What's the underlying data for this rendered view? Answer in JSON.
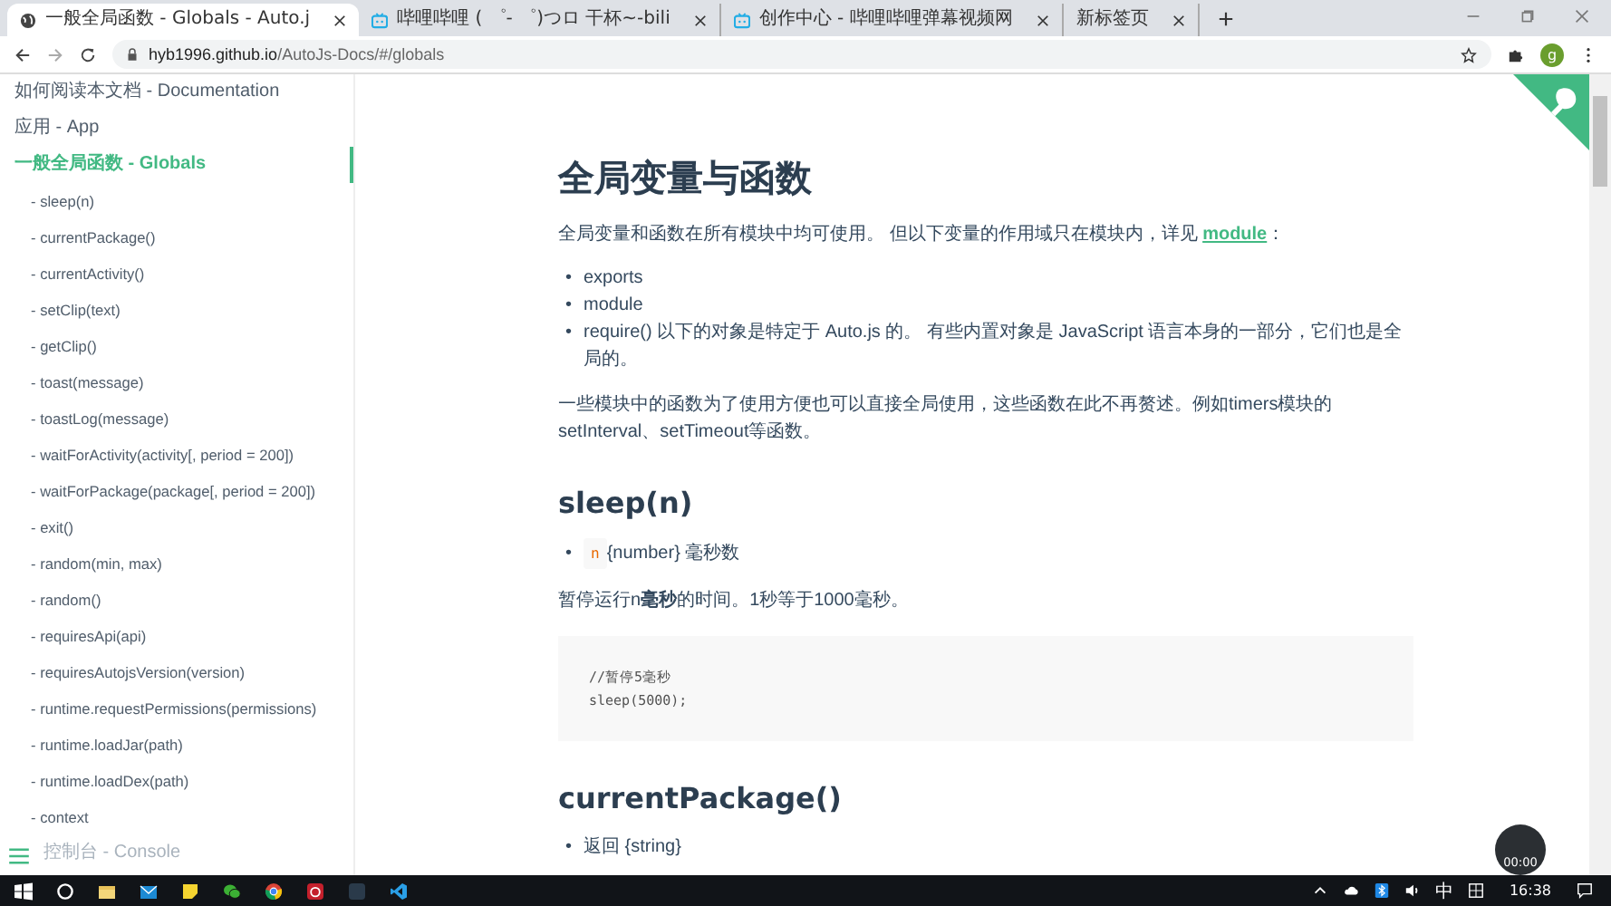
{
  "tabs": [
    {
      "title": "一般全局函数 - Globals - Auto.j",
      "kind": "globe",
      "selected": true
    },
    {
      "title": "哔哩哔哩 ( ゜- ゜)つロ 干杯~-bili",
      "kind": "tv",
      "selected": false
    },
    {
      "title": "创作中心 - 哔哩哔哩弹幕视频网",
      "kind": "tv",
      "selected": false
    },
    {
      "title": "新标签页",
      "kind": "none",
      "selected": false
    }
  ],
  "address": {
    "host": "hyb1996.github.io",
    "path": "/AutoJs-Docs/#/globals"
  },
  "profile": "g",
  "sidebar": {
    "items": [
      {
        "label": "如何阅读本文档 - Documentation",
        "kind": "section",
        "selected": false
      },
      {
        "label": "应用 - App",
        "kind": "section",
        "selected": false
      },
      {
        "label": "一般全局函数 - Globals",
        "kind": "section",
        "selected": true
      },
      {
        "label": "- sleep(n)",
        "kind": "sub",
        "selected": false
      },
      {
        "label": "- currentPackage()",
        "kind": "sub",
        "selected": false
      },
      {
        "label": "- currentActivity()",
        "kind": "sub",
        "selected": false
      },
      {
        "label": "- setClip(text)",
        "kind": "sub",
        "selected": false
      },
      {
        "label": "- getClip()",
        "kind": "sub",
        "selected": false
      },
      {
        "label": "- toast(message)",
        "kind": "sub",
        "selected": false
      },
      {
        "label": "- toastLog(message)",
        "kind": "sub",
        "selected": false
      },
      {
        "label": "- waitForActivity(activity[, period = 200])",
        "kind": "sub",
        "selected": false
      },
      {
        "label": "- waitForPackage(package[, period = 200])",
        "kind": "sub",
        "selected": false
      },
      {
        "label": "- exit()",
        "kind": "sub",
        "selected": false
      },
      {
        "label": "- random(min, max)",
        "kind": "sub",
        "selected": false
      },
      {
        "label": "- random()",
        "kind": "sub",
        "selected": false
      },
      {
        "label": "- requiresApi(api)",
        "kind": "sub",
        "selected": false
      },
      {
        "label": "- requiresAutojsVersion(version)",
        "kind": "sub",
        "selected": false
      },
      {
        "label": "- runtime.requestPermissions(permissions)",
        "kind": "sub",
        "selected": false
      },
      {
        "label": "- runtime.loadJar(path)",
        "kind": "sub",
        "selected": false
      },
      {
        "label": "- runtime.loadDex(path)",
        "kind": "sub",
        "selected": false
      },
      {
        "label": "- context",
        "kind": "sub",
        "selected": false
      },
      {
        "label": "控制台 - Console",
        "kind": "section",
        "selected": false
      }
    ]
  },
  "content": {
    "title": "全局变量与函数",
    "intro": {
      "text": "全局变量和函数在所有模块中均可使用。 但以下变量的作用域只在模块内，详见 ",
      "link": "module",
      "after": "："
    },
    "marker": "•",
    "bullets": [
      "exports",
      "module",
      "require() 以下的对象是特定于 Auto.js 的。 有些内置对象是 JavaScript 语言本身的一部分，它们也是全局的。"
    ],
    "paragraph": "一些模块中的函数为了使用方便也可以直接全局使用，这些函数在此不再赘述。例如timers模块的setInterval、setTimeout等函数。",
    "sections": [
      {
        "title": "sleep(n)",
        "items": [
          {
            "kind": "param",
            "name": "n",
            "text": "{number} 毫秒数"
          }
        ],
        "description": "暂停运行n**毫秒**的时间。1秒等于1000毫秒。",
        "code": [
          "//暂停5毫秒",
          "sleep(5000);"
        ]
      },
      {
        "title": "currentPackage()",
        "items": [
          {
            "kind": "return",
            "text": "返回 {string}"
          }
        ]
      }
    ]
  },
  "timer": "00:00",
  "taskbar": {
    "ime": "中",
    "time": "16:38"
  }
}
